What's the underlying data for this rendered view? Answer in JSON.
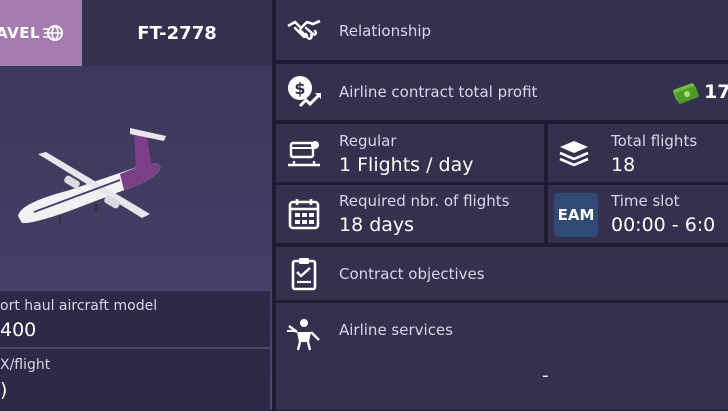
{
  "header": {
    "airline_brand": "AVEL",
    "flight_code": "FT-2778"
  },
  "aircraft": {
    "model_label": "ort haul aircraft model",
    "model_value": "400",
    "cost_label": "X/flight",
    "cost_value": ")"
  },
  "contract": {
    "relationship_label": "Relationship",
    "profit_label": "Airline contract total profit",
    "profit_value": "17",
    "regular_label": "Regular",
    "regular_value": "1 Flights / day",
    "total_flights_label": "Total flights",
    "total_flights_value": "18",
    "required_label": "Required nbr. of flights",
    "required_value": "18 days",
    "time_slot_badge": "EAM",
    "time_slot_label": "Time slot",
    "time_slot_value": "00:00 - 6:0",
    "objectives_label": "Contract objectives",
    "services_label": "Airline services",
    "services_value": "-"
  },
  "colors": {
    "panel": "#34314f",
    "background": "#1e1c33",
    "brand": "#a67bb0",
    "eam_badge": "#2f4b75",
    "money": "#6fbf3a"
  },
  "icons": [
    "handshake-icon",
    "profit-chart-icon",
    "cash-icon",
    "airport-schedule-icon",
    "stacked-flights-icon",
    "calendar-icon",
    "clipboard-icon",
    "service-staff-icon",
    "globe-icon"
  ]
}
